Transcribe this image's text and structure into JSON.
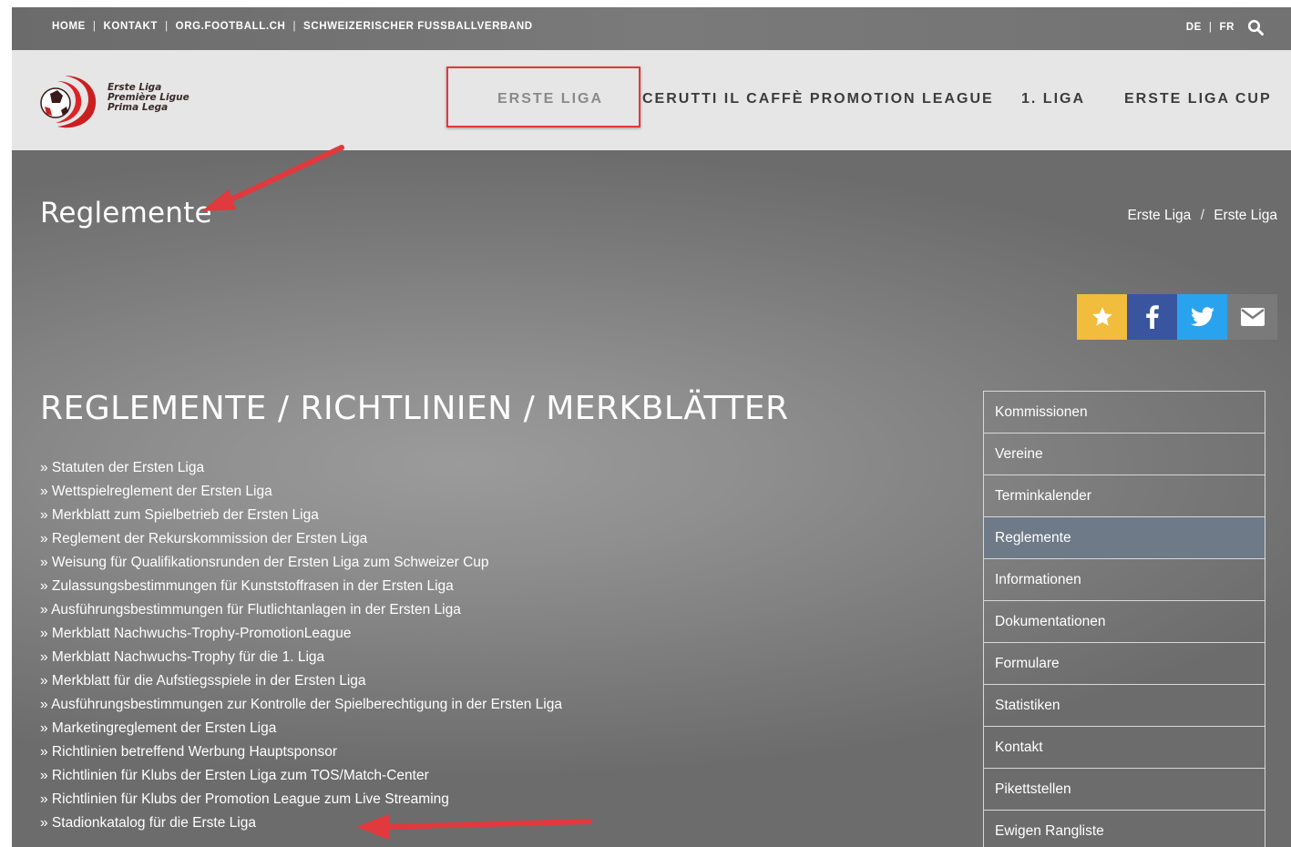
{
  "topbar": {
    "links": [
      "HOME",
      "KONTAKT",
      "ORG.FOOTBALL.CH",
      "SCHWEIZERISCHER FUSSBALLVERBAND"
    ],
    "lang": [
      "DE",
      "FR"
    ],
    "search_icon": "search-icon"
  },
  "logo": {
    "lines": [
      "Erste Liga",
      "Première Ligue",
      "Prima Lega"
    ]
  },
  "nav": [
    "ERSTE LIGA",
    "CERUTTI IL CAFFÈ PROMOTION LEAGUE",
    "1. LIGA",
    "ERSTE LIGA CUP"
  ],
  "page": {
    "title": "Reglemente",
    "breadcrumb": [
      "Erste Liga",
      "Erste Liga"
    ],
    "section_title": "REGLEMENTE / RICHTLINIEN / MERKBLÄTTER"
  },
  "share": {
    "buttons": [
      "star-icon",
      "facebook-icon",
      "twitter-icon",
      "mail-icon"
    ]
  },
  "documents": [
    "» Statuten der Ersten Liga",
    "» Wettspielreglement der Ersten Liga",
    "» Merkblatt zum Spielbetrieb der Ersten Liga",
    "» Reglement der Rekurskommission der Ersten Liga",
    "» Weisung für Qualifikationsrunden der Ersten Liga zum Schweizer Cup",
    "» Zulassungsbestimmungen für Kunststoffrasen in der Ersten Liga",
    "» Ausführungsbestimmungen für Flutlichtanlagen in der Ersten Liga",
    "» Merkblatt Nachwuchs-Trophy-PromotionLeague",
    "» Merkblatt Nachwuchs-Trophy für die 1. Liga",
    "» Merkblatt für die Aufstiegsspiele in der Ersten Liga",
    "» Ausführungsbestimmungen zur Kontrolle der Spielberechtigung in der Ersten Liga",
    "» Marketingreglement der Ersten Liga",
    "» Richtlinien betreffend Werbung Hauptsponsor",
    "» Richtlinien für Klubs der Ersten Liga zum TOS/Match-Center",
    "» Richtlinien für Klubs der Promotion League zum Live Streaming",
    "» Stadionkatalog für die Erste Liga"
  ],
  "sidebar": {
    "items": [
      "Kommissionen",
      "Vereine",
      "Terminkalender",
      "Reglemente",
      "Informationen",
      "Dokumentationen",
      "Formulare",
      "Statistiken",
      "Kontakt",
      "Pikettstellen",
      "Ewigen Rangliste"
    ],
    "active": "Reglemente"
  },
  "colors": {
    "annotation": "#e0393e",
    "star": "#f2bd3c",
    "facebook": "#3a559f",
    "twitter": "#2aa3ef",
    "sidebar_active": "#6f7a88"
  }
}
